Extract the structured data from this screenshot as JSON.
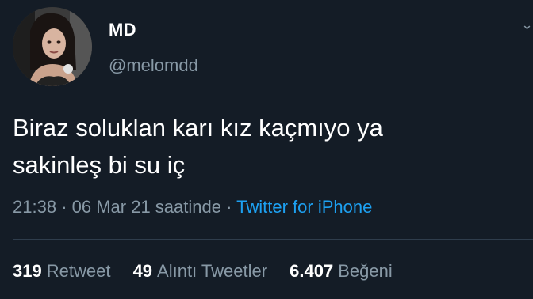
{
  "tweet": {
    "display_name": "MD",
    "handle": "@melomdd",
    "text": "Biraz soluklan karı kız kaçmıyo ya\nsakinleş bi su iç",
    "time": "21:38",
    "separator": "·",
    "date_suffix": "06 Mar 21 saatinde",
    "source": "Twitter for iPhone",
    "more_icon": "chevron-down-icon",
    "avatar_icon": "profile-photo"
  },
  "stats": {
    "retweets_count": "319",
    "retweets_label": "Retweet",
    "quotes_count": "49",
    "quotes_label": "Alıntı Tweetler",
    "likes_count": "6.407",
    "likes_label": "Beğeni"
  },
  "colors": {
    "background": "#141c26",
    "secondary_text": "#8899a6",
    "link": "#1da1f2"
  }
}
